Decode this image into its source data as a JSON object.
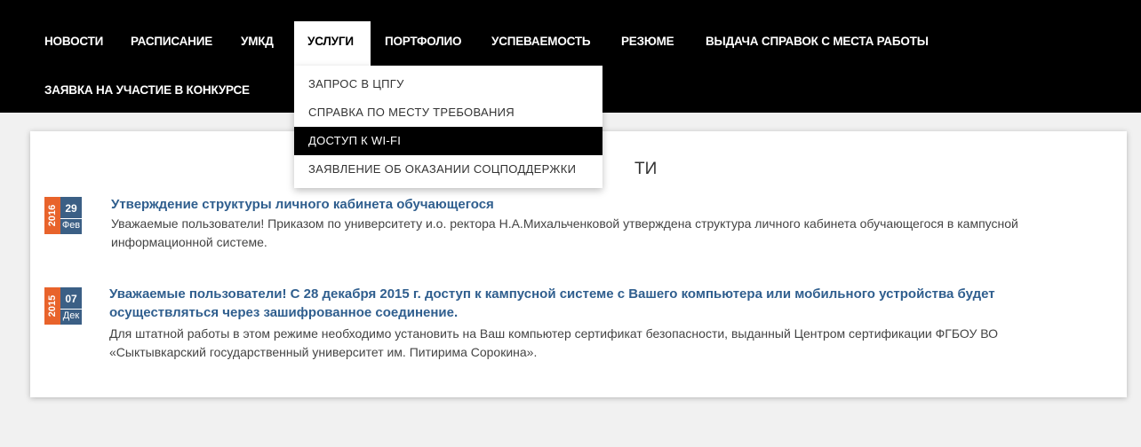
{
  "nav": {
    "items": [
      "Новости",
      "Расписание",
      "УМКД",
      "Услуги",
      "Портфолио",
      "Успеваемость",
      "Резюме",
      "Выдача справок с места работы"
    ],
    "second_row": "Заявка на участие в конкурсе"
  },
  "dropdown": {
    "items": [
      "Запрос в ЦПГУ",
      "Справка по месту требования",
      "Доступ к Wi-Fi",
      "Заявление об оказании соцподдержки"
    ]
  },
  "card": {
    "title_partial": "ТИ"
  },
  "news": [
    {
      "year": "2016",
      "day": "29",
      "month": "Фев",
      "title": "Утверждение структуры личного кабинета обучающегося",
      "text": "Уважаемые пользователи!  Приказом по университету  и.о. ректора Н.А.Михальченковой  утверждена структура личного кабинета обучающегося в кампусной информационной системе."
    },
    {
      "year": "2015",
      "day": "07",
      "month": "Дек",
      "title": "Уважаемые пользователи! С 28 декабря 2015 г. доступ к кампусной системе с Вашего компьютера или мобильного устройства будет осуществляться через зашифрованное соединение.",
      "text": "Для штатной работы в этом режиме необходимо установить на Ваш компьютер сертификат безопасности, выданный Центром сертификации ФГБОУ ВО «Сыктывкарский государственный университет им. Питирима Сорокина»."
    }
  ],
  "colors": {
    "nav_bg": "#000000",
    "year_badge": "#e8632b",
    "day_badge": "#3b5f85",
    "link": "#2f5e8e"
  }
}
